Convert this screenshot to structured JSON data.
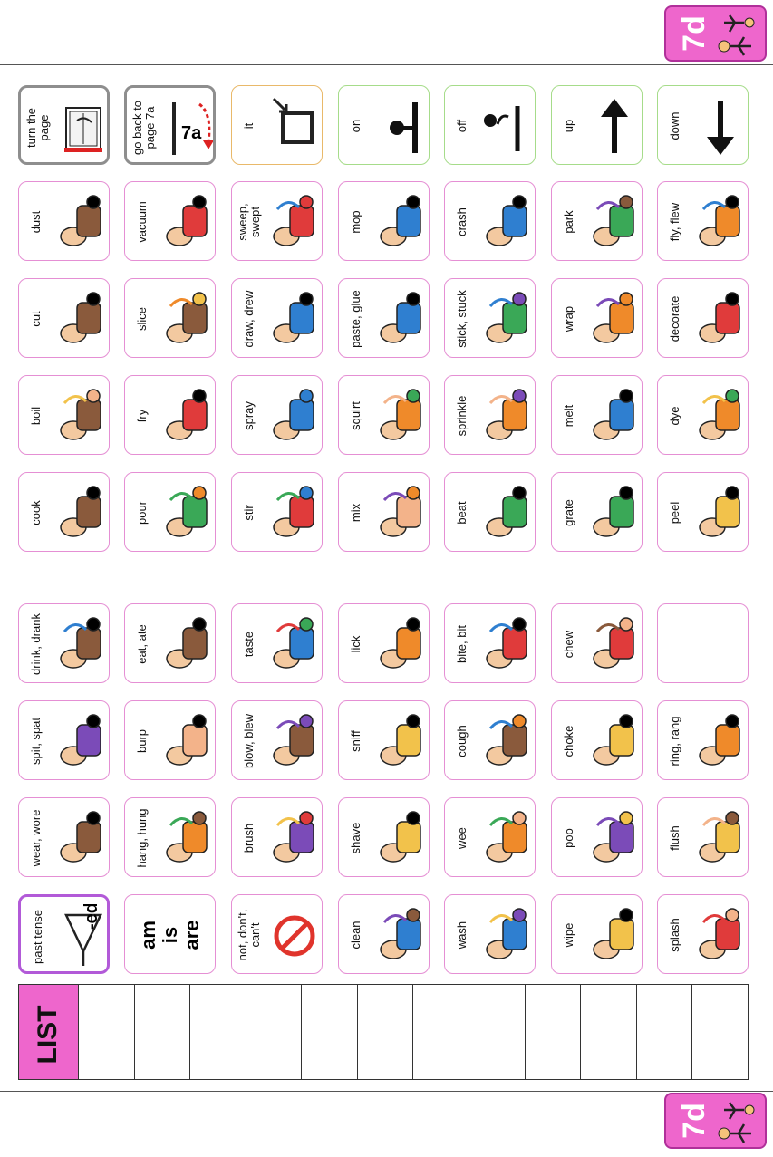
{
  "page_tab": {
    "label": "7d"
  },
  "list": {
    "title": "LIST",
    "blank_count": 12
  },
  "rows": [
    {
      "cells": [
        {
          "label": "turn the\npage",
          "icon": "book-page-icon",
          "style": "gray"
        },
        {
          "label": "dust",
          "icon": "dust-icon"
        },
        {
          "label": "cut",
          "icon": "knife-cut-icon"
        },
        {
          "label": "boil",
          "icon": "boiling-pot-icon"
        },
        {
          "label": "cook",
          "icon": "cooking-stove-icon"
        },
        {
          "label": "drink, drank",
          "icon": "drinking-icon"
        },
        {
          "label": "spit, spat",
          "icon": "spit-icon"
        },
        {
          "label": "wear, wore",
          "icon": "wear-clothes-icon"
        },
        {
          "label": "past tense",
          "icon": "past-tense-ed-icon",
          "style": "purple",
          "extra": "-ed"
        }
      ]
    },
    {
      "cells": [
        {
          "label": "go back to\npage 7a",
          "icon": "go-back-arrow-icon",
          "style": "gray",
          "extra": "7a"
        },
        {
          "label": "vacuum",
          "icon": "vacuum-icon"
        },
        {
          "label": "slice",
          "icon": "slice-icon"
        },
        {
          "label": "fry",
          "icon": "frying-pan-icon"
        },
        {
          "label": "pour",
          "icon": "pour-jug-icon"
        },
        {
          "label": "eat, ate",
          "icon": "eating-icon"
        },
        {
          "label": "burp",
          "icon": "burp-icon"
        },
        {
          "label": "hang, hung",
          "icon": "hanger-icon"
        },
        {
          "type": "amisare",
          "words": [
            "am",
            "is",
            "are"
          ]
        }
      ]
    },
    {
      "cells": [
        {
          "label": "it",
          "icon": "it-box-pointer-icon",
          "style": "orange"
        },
        {
          "label": "sweep,\nswept",
          "icon": "broom-icon"
        },
        {
          "label": "draw, drew",
          "icon": "drawing-icon"
        },
        {
          "label": "spray",
          "icon": "spray-bottle-icon"
        },
        {
          "label": "stir",
          "icon": "stir-bowl-icon"
        },
        {
          "label": "taste",
          "icon": "tongue-taste-icon"
        },
        {
          "label": "blow, blew",
          "icon": "blow-icon"
        },
        {
          "label": "brush",
          "icon": "hairbrush-icon"
        },
        {
          "label": "not, don't,\ncan't",
          "icon": "no-sign-icon"
        }
      ]
    },
    {
      "cells": [
        {
          "label": "on",
          "icon": "on-position-icon",
          "style": "green"
        },
        {
          "label": "mop",
          "icon": "mop-icon"
        },
        {
          "label": "paste, glue",
          "icon": "glue-bottle-icon"
        },
        {
          "label": "squirt",
          "icon": "squirt-gun-icon"
        },
        {
          "label": "mix",
          "icon": "mixer-icon"
        },
        {
          "label": "lick",
          "icon": "lollipop-lick-icon"
        },
        {
          "label": "sniff",
          "icon": "nose-sniff-icon"
        },
        {
          "label": "shave",
          "icon": "razor-shave-icon"
        },
        {
          "label": "clean",
          "icon": "cleaning-cloth-icon"
        }
      ]
    },
    {
      "cells": [
        {
          "label": "off",
          "icon": "off-position-icon",
          "style": "green"
        },
        {
          "label": "crash",
          "icon": "car-crash-icon"
        },
        {
          "label": "stick, stuck",
          "icon": "sticky-hand-icon"
        },
        {
          "label": "sprinkle",
          "icon": "sprinkle-shaker-icon"
        },
        {
          "label": "beat",
          "icon": "whisk-beat-icon"
        },
        {
          "label": "bite, bit",
          "icon": "teeth-bite-icon"
        },
        {
          "label": "cough",
          "icon": "cough-icon"
        },
        {
          "label": "wee",
          "icon": "toilet-wee-icon"
        },
        {
          "label": "wash",
          "icon": "wash-hands-icon"
        }
      ]
    },
    {
      "cells": [
        {
          "label": "up",
          "icon": "up-arrow-icon",
          "style": "green"
        },
        {
          "label": "park",
          "icon": "parked-cars-icon"
        },
        {
          "label": "wrap",
          "icon": "gift-wrap-icon"
        },
        {
          "label": "melt",
          "icon": "snowman-melt-icon"
        },
        {
          "label": "grate",
          "icon": "grater-icon"
        },
        {
          "label": "chew",
          "icon": "mouth-chew-icon"
        },
        {
          "label": "choke",
          "icon": "choke-icon"
        },
        {
          "label": "poo",
          "icon": "toilet-poo-icon"
        },
        {
          "label": "wipe",
          "icon": "wipe-cloth-icon"
        }
      ]
    },
    {
      "cells": [
        {
          "label": "down",
          "icon": "down-arrow-icon",
          "style": "green"
        },
        {
          "label": "fly, flew",
          "icon": "bird-fly-icon"
        },
        {
          "label": "decorate",
          "icon": "decorate-icon"
        },
        {
          "label": "dye",
          "icon": "dye-bucket-icon"
        },
        {
          "label": "peel",
          "icon": "banana-peel-icon"
        },
        {
          "label": "",
          "icon": "",
          "blank": true
        },
        {
          "label": "ring, rang",
          "icon": "phone-ring-icon"
        },
        {
          "label": "flush",
          "icon": "toilet-flush-icon"
        },
        {
          "label": "splash",
          "icon": "water-splash-icon"
        }
      ]
    }
  ]
}
